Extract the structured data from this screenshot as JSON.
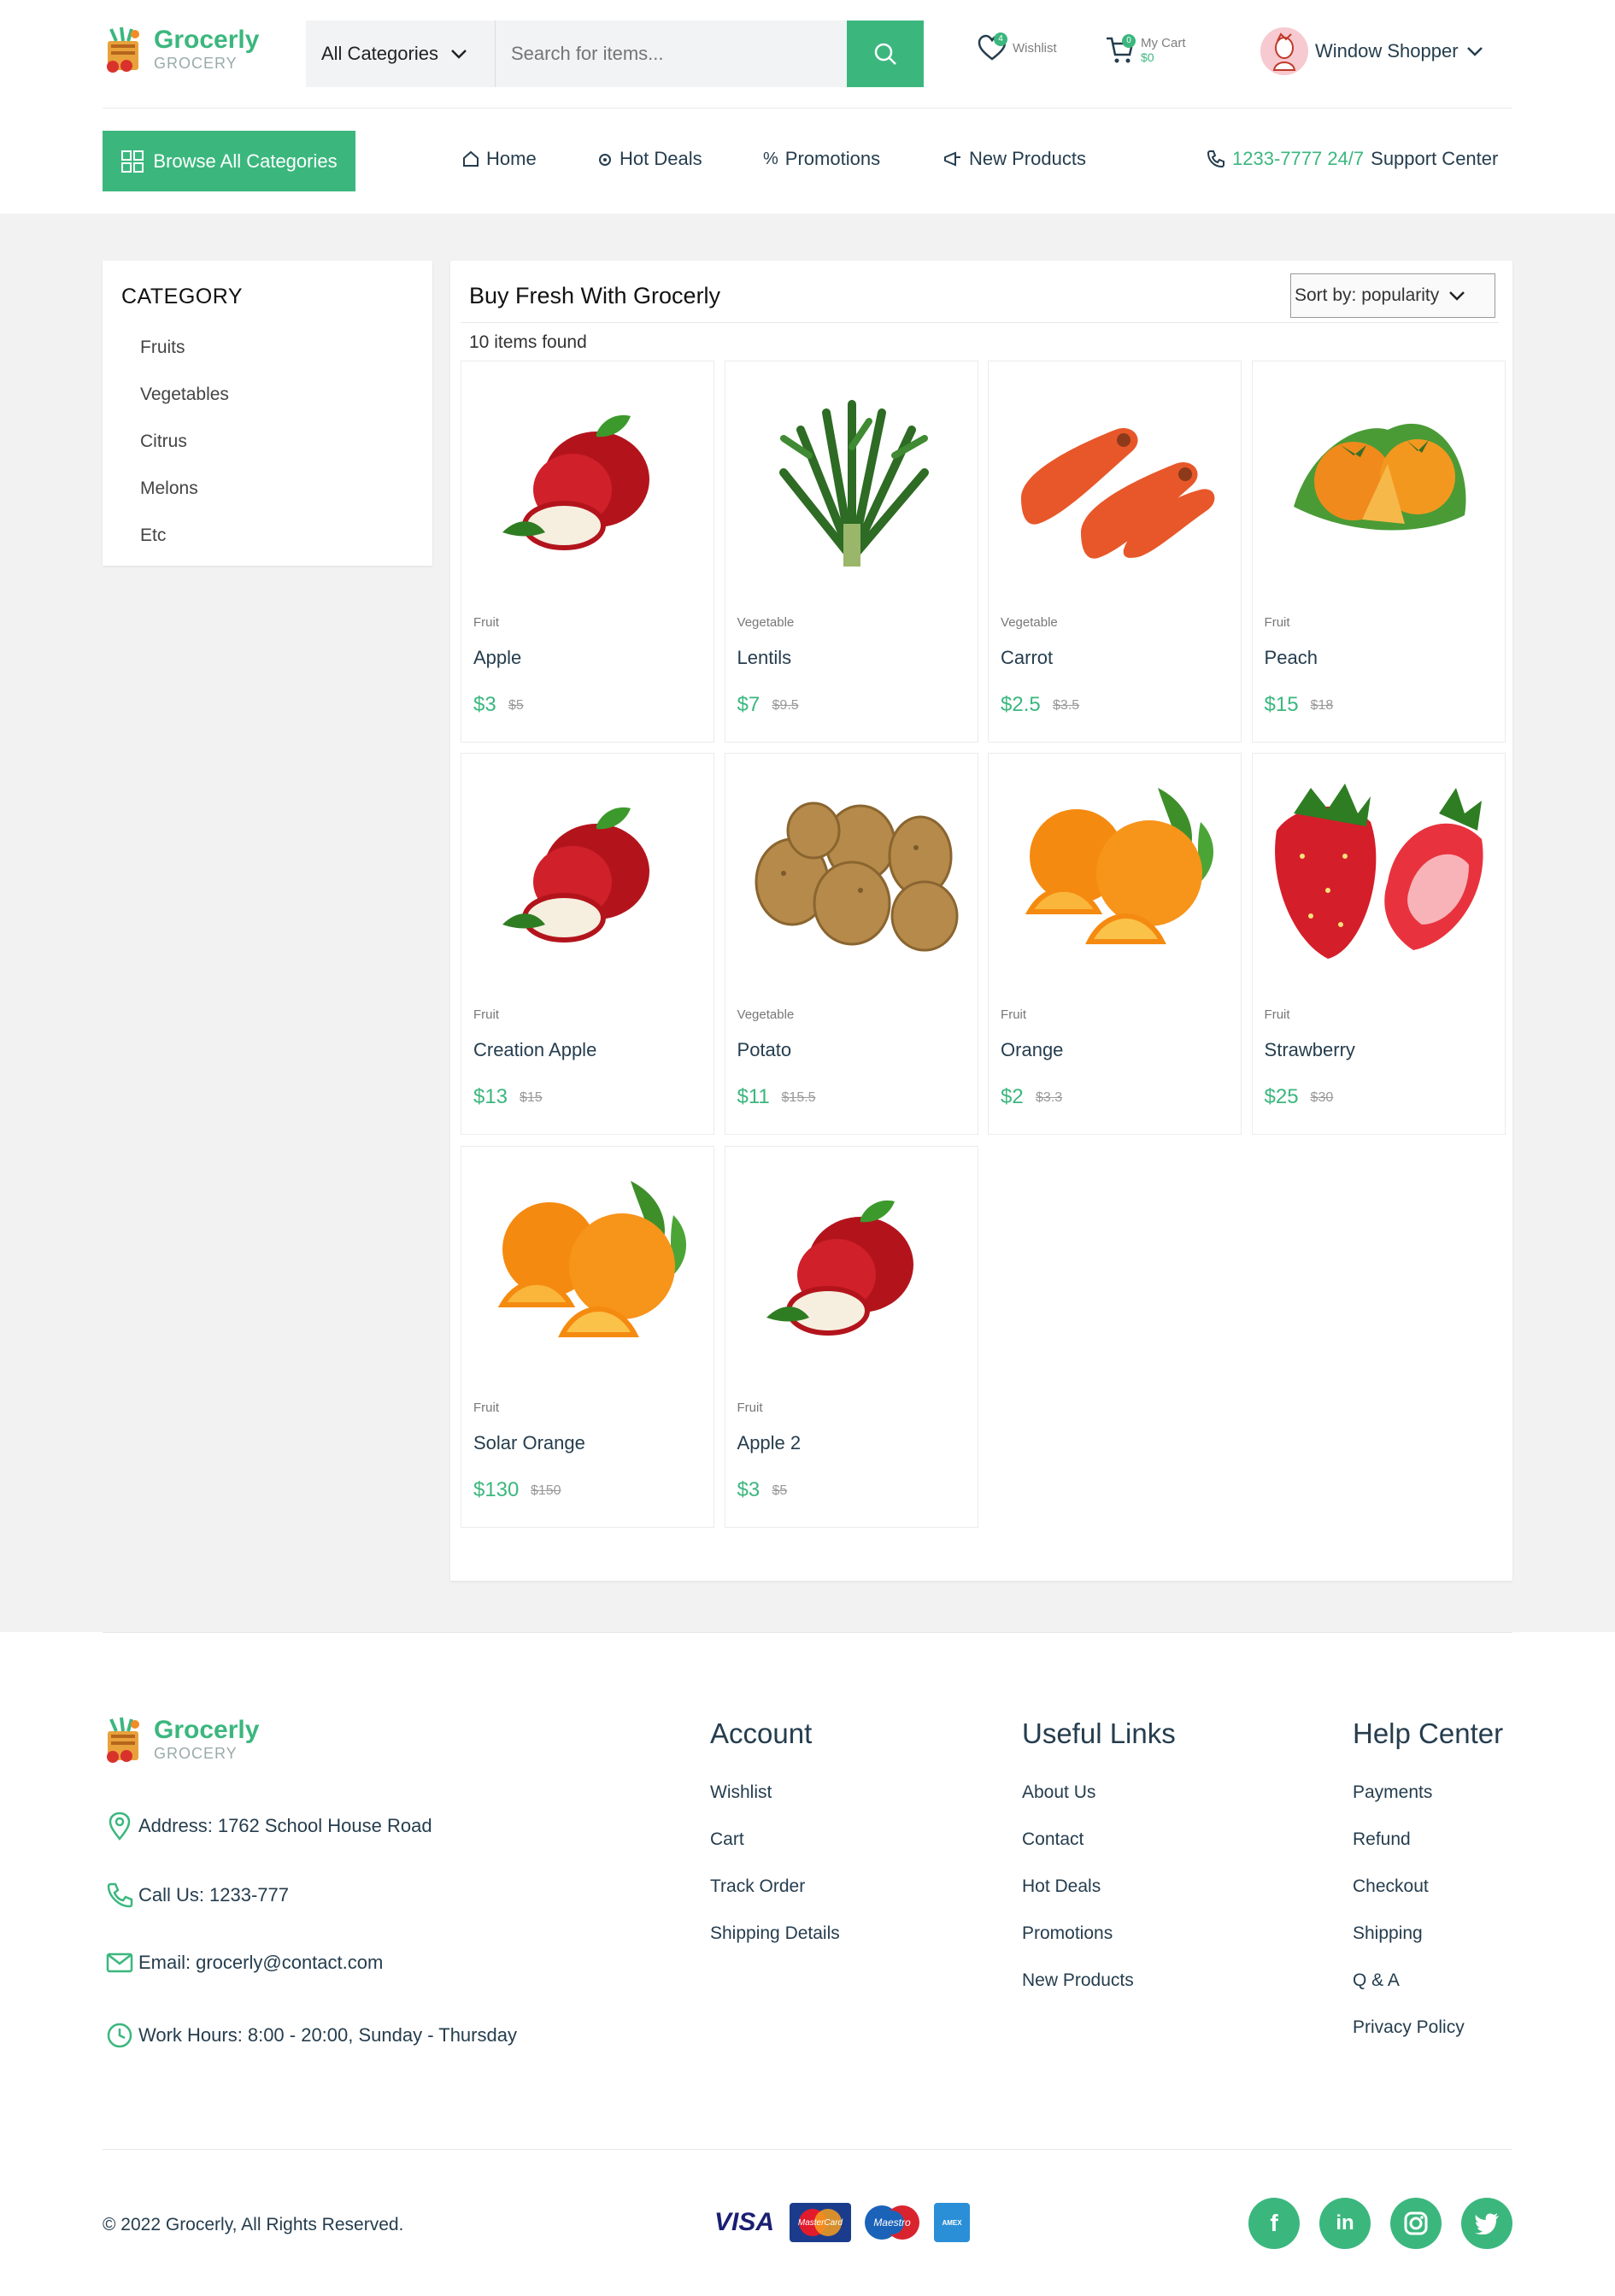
{
  "brand": {
    "name": "Grocerly",
    "tag": "GROCERY"
  },
  "search": {
    "category": "All Categories",
    "placeholder": "Search for items..."
  },
  "wishlist": {
    "label": "Wishlist",
    "count": "4"
  },
  "cart": {
    "label": "My Cart",
    "total": "$0",
    "count": "0"
  },
  "user": {
    "name": "Window Shopper"
  },
  "nav": {
    "browse": "Browse All Categories",
    "items": [
      "Home",
      "Hot Deals",
      "Promotions",
      "New Products"
    ],
    "support_number": "1233-7777 24/7",
    "support_label": "Support Center"
  },
  "sidebar": {
    "title": "CATEGORY",
    "items": [
      "Fruits",
      "Vegetables",
      "Citrus",
      "Melons",
      "Etc"
    ]
  },
  "products": {
    "title": "Buy Fresh With Grocerly",
    "sort": "Sort by: popularity",
    "found": "10 items found",
    "items": [
      {
        "type": "Fruit",
        "name": "Apple",
        "price": "$3",
        "old": "$5",
        "image": "apple"
      },
      {
        "type": "Vegetable",
        "name": "Lentils",
        "price": "$7",
        "old": "$9.5",
        "image": "greens"
      },
      {
        "type": "Vegetable",
        "name": "Carrot",
        "price": "$2.5",
        "old": "$3.5",
        "image": "carrot"
      },
      {
        "type": "Fruit",
        "name": "Peach",
        "price": "$15",
        "old": "$18",
        "image": "persimmon"
      },
      {
        "type": "Fruit",
        "name": "Creation Apple",
        "price": "$13",
        "old": "$15",
        "image": "apple"
      },
      {
        "type": "Vegetable",
        "name": "Potato",
        "price": "$11",
        "old": "$15.5",
        "image": "potato"
      },
      {
        "type": "Fruit",
        "name": "Orange",
        "price": "$2",
        "old": "$3.3",
        "image": "orange"
      },
      {
        "type": "Fruit",
        "name": "Strawberry",
        "price": "$25",
        "old": "$30",
        "image": "strawberry"
      },
      {
        "type": "Fruit",
        "name": "Solar Orange",
        "price": "$130",
        "old": "$150",
        "image": "orange"
      },
      {
        "type": "Fruit",
        "name": "Apple 2",
        "price": "$3",
        "old": "$5",
        "image": "apple"
      }
    ]
  },
  "footer": {
    "address_label": "Address:",
    "address": "1762 School House Road",
    "call_label": "Call Us:",
    "call": "1233-777",
    "email_label": "Email:",
    "email": "grocerly@contact.com",
    "hours_label": "Work Hours:",
    "hours": "8:00 - 20:00, Sunday - Thursday",
    "account": {
      "title": "Account",
      "links": [
        "Wishlist",
        "Cart",
        "Track Order",
        "Shipping Details"
      ]
    },
    "useful": {
      "title": "Useful Links",
      "links": [
        "About Us",
        "Contact",
        "Hot Deals",
        "Promotions",
        "New Products"
      ]
    },
    "help": {
      "title": "Help Center",
      "links": [
        "Payments",
        "Refund",
        "Checkout",
        "Shipping",
        "Q & A",
        "Privacy Policy"
      ]
    },
    "copyright": "© 2022 Grocerly, All Rights Reserved.",
    "payments": [
      "VISA",
      "MasterCard",
      "Maestro",
      "AMEX"
    ],
    "social": [
      "facebook-icon",
      "linkedin-icon",
      "instagram-icon",
      "twitter-icon"
    ]
  },
  "colors": {
    "accent": "#3BB77E",
    "text": "#253D4E",
    "background": "#F2F2F2"
  }
}
